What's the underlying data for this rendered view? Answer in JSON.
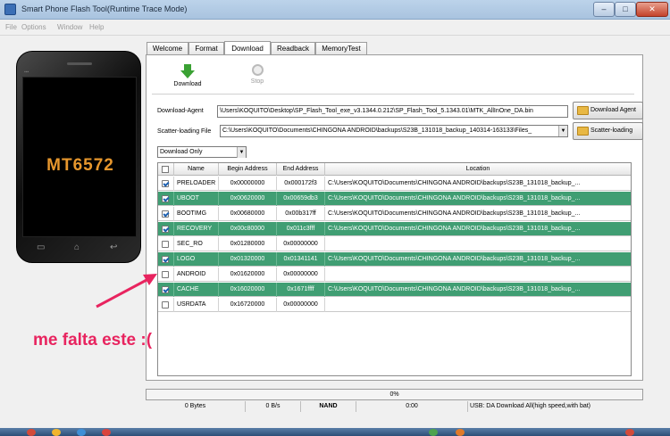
{
  "window": {
    "title": "Smart Phone Flash Tool(Runtime Trace Mode)"
  },
  "menu": [
    "File",
    "Options",
    "Window",
    "Help"
  ],
  "phone": {
    "model": "MT6572"
  },
  "tabs": [
    "Welcome",
    "Format",
    "Download",
    "Readback",
    "MemoryTest"
  ],
  "toolbar": {
    "download_label": "Download",
    "stop_label": "Stop"
  },
  "download_agent": {
    "label": "Download-Agent",
    "path": "\\Users\\KOQUITO\\Desktop\\SP_Flash_Tool_exe_v3.1344.0.212\\SP_Flash_Tool_5.1343.01\\MTK_AllInOne_DA.bin",
    "button": "Download Agent"
  },
  "scatter": {
    "label": "Scatter-loading File",
    "path": "C:\\Users\\KOQUITO\\Documents\\CHINGONA ANDROID\\backups\\S23B_131018_backup_140314-163133\\Files_",
    "button": "Scatter-loading"
  },
  "mode_select": {
    "value": "Download Only"
  },
  "table": {
    "headers": [
      "Name",
      "Begin Address",
      "End Address",
      "Location"
    ],
    "rows": [
      {
        "checked": true,
        "name": "PRELOADER",
        "begin": "0x00000000",
        "end": "0x000172f3",
        "location": "C:\\Users\\KOQUITO\\Documents\\CHINGONA ANDROID\\backups\\S23B_131018_backup_..."
      },
      {
        "checked": true,
        "name": "UBOOT",
        "begin": "0x00620000",
        "end": "0x00659db3",
        "location": "C:\\Users\\KOQUITO\\Documents\\CHINGONA ANDROID\\backups\\S23B_131018_backup_..."
      },
      {
        "checked": true,
        "name": "BOOTIMG",
        "begin": "0x00680000",
        "end": "0x00b317ff",
        "location": "C:\\Users\\KOQUITO\\Documents\\CHINGONA ANDROID\\backups\\S23B_131018_backup_..."
      },
      {
        "checked": true,
        "name": "RECOVERY",
        "begin": "0x00c80000",
        "end": "0x011c3fff",
        "location": "C:\\Users\\KOQUITO\\Documents\\CHINGONA ANDROID\\backups\\S23B_131018_backup_..."
      },
      {
        "checked": false,
        "name": "SEC_RO",
        "begin": "0x01280000",
        "end": "0x00000000",
        "location": ""
      },
      {
        "checked": true,
        "name": "LOGO",
        "begin": "0x01320000",
        "end": "0x01341141",
        "location": "C:\\Users\\KOQUITO\\Documents\\CHINGONA ANDROID\\backups\\S23B_131018_backup_..."
      },
      {
        "checked": false,
        "name": "ANDROID",
        "begin": "0x01620000",
        "end": "0x00000000",
        "location": ""
      },
      {
        "checked": true,
        "name": "CACHE",
        "begin": "0x16020000",
        "end": "0x1671ffff",
        "location": "C:\\Users\\KOQUITO\\Documents\\CHINGONA ANDROID\\backups\\S23B_131018_backup_..."
      },
      {
        "checked": false,
        "name": "USRDATA",
        "begin": "0x16720000",
        "end": "0x00000000",
        "location": ""
      }
    ]
  },
  "annotation": {
    "text": "me falta este :(",
    "color": "#e8245f"
  },
  "progress": {
    "percent_text": "0%",
    "value": 0
  },
  "status": {
    "bytes": "0 Bytes",
    "speed": "0 B/s",
    "storage": "NAND",
    "time": "0:00",
    "info": "USB: DA Download All(high speed,with bat)"
  },
  "colors": {
    "row_highlight": "#409e73",
    "accent": "#3aa133"
  }
}
